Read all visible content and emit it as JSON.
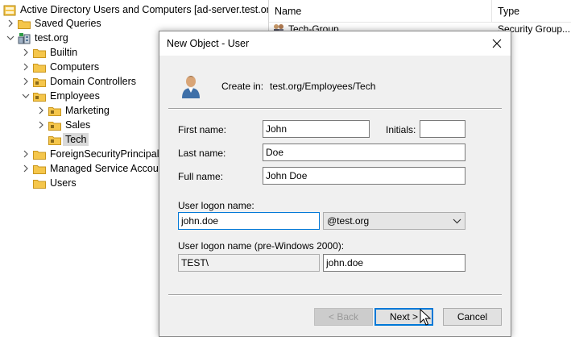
{
  "tree": {
    "root_label": "Active Directory Users and Computers [ad-server.test.org]",
    "items": [
      {
        "label": "Saved Queries",
        "chevron": "right"
      },
      {
        "label": "test.org",
        "chevron": "down"
      },
      {
        "label": "Builtin",
        "chevron": "right"
      },
      {
        "label": "Computers",
        "chevron": "right"
      },
      {
        "label": "Domain Controllers",
        "chevron": "right"
      },
      {
        "label": "Employees",
        "chevron": "down"
      },
      {
        "label": "Marketing",
        "chevron": "right"
      },
      {
        "label": "Sales",
        "chevron": "right"
      },
      {
        "label": "Tech",
        "chevron": ""
      },
      {
        "label": "ForeignSecurityPrincipals",
        "chevron": "right"
      },
      {
        "label": "Managed Service Accounts",
        "chevron": "right"
      },
      {
        "label": "Users",
        "chevron": ""
      }
    ]
  },
  "list": {
    "columns": [
      "Name",
      "Type"
    ],
    "rows": [
      {
        "name": "Tech-Group",
        "type": "Security Group..."
      }
    ]
  },
  "dialog": {
    "title": "New Object - User",
    "create_in_label": "Create in:",
    "create_in_value": "test.org/Employees/Tech",
    "first_name_label": "First name:",
    "first_name": "John",
    "initials_label": "Initials:",
    "initials": "",
    "last_name_label": "Last name:",
    "last_name": "Doe",
    "full_name_label": "Full name:",
    "full_name": "John Doe",
    "logon_label": "User logon name:",
    "logon_name": "john.doe",
    "domain_suffix": "@test.org",
    "pre2000_label": "User logon name (pre-Windows 2000):",
    "pre2000_domain": "TEST\\",
    "pre2000_name": "john.doe",
    "back_label": "< Back",
    "next_label": "Next >",
    "cancel_label": "Cancel"
  },
  "colors": {
    "accent": "#0078d7",
    "folder_yellow": "#f5c64b",
    "selected_bg": "#d9d9d9",
    "dialog_bg": "#f0f0f0"
  }
}
